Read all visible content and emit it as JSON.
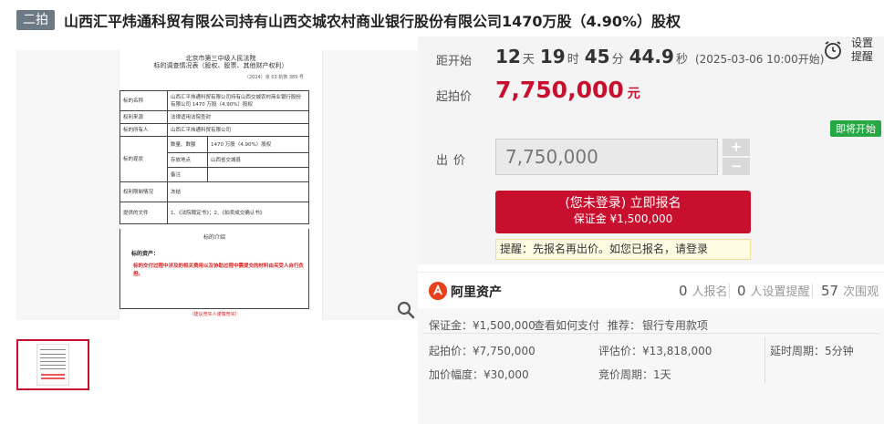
{
  "header": {
    "round_badge": "二拍",
    "title": "山西汇平炜通科贸有限公司持有山西交城农村商业银行股份有限公司1470万股（4.90%）股权"
  },
  "document": {
    "court": "北京市第三中级人民法院",
    "doc_title": "标的调查情况表（股权、股票、其他财产权利）",
    "doc_no": "（2024）京 03 执恢 385 号",
    "rows": [
      {
        "label": "标的名称",
        "value": "山西汇平炜通科贸有限公司持有山西交城农村商业银行股份有限公司 1470 万股（4.90%）股权"
      },
      {
        "label": "权利来源",
        "value": "法律适用法院查封"
      },
      {
        "label": "标的所有人",
        "value": "山西汇平炜通科贸有限公司"
      },
      {
        "label": "标的现状",
        "sub": [
          {
            "label": "数量、数额",
            "value": "1470 万股（4.90%）股权"
          },
          {
            "label": "存放地点",
            "value": "山西省交城县"
          },
          {
            "label": "备注",
            "value": ""
          }
        ]
      },
      {
        "label": "权利限制情况",
        "value": "冻结"
      },
      {
        "label": "提供的文件",
        "value": "1、《法院裁定书》；2、《拍卖成交确认书》"
      }
    ],
    "section_title": "标的介绍",
    "section_label": "标的资产：",
    "red_note": "标的交付过程中涉及的相关费用以及协助过程中需提交的材料由买受人自行负担。",
    "footer_note": "（建议竞买人谨慎竞买）"
  },
  "countdown": {
    "label": "距开始",
    "days": "12",
    "days_unit": "天",
    "hours": "19",
    "hours_unit": "时",
    "minutes": "45",
    "minutes_unit": "分",
    "seconds": "44.9",
    "seconds_unit": "秒",
    "start_note": "(2025-03-06 10:00开始)"
  },
  "reminder": {
    "line1": "设置",
    "line2": "提醒"
  },
  "start_price": {
    "label": "起拍价",
    "value": "7,750,000",
    "unit": "元"
  },
  "bid": {
    "status_tag": "即将开始",
    "label": "出价",
    "input_value": "7,750,000",
    "plus": "+",
    "minus": "−",
    "signup_main": "(您未登录) 立即报名",
    "signup_sub": "保证金 ¥1,500,000",
    "tip": "提醒：先报名再出价。如您已报名，请登录"
  },
  "platform": {
    "name": "阿里资产",
    "stats": [
      {
        "n": "0",
        "label": "人报名"
      },
      {
        "n": "0",
        "label": "人设置提醒"
      },
      {
        "n": "57",
        "label": "次围观"
      }
    ]
  },
  "info": {
    "deposit": "保证金：¥1,500,000",
    "deposit_link": "查看如何支付",
    "recommend_label": "推荐：",
    "recommend_link": "银行专用款项",
    "start_price": "起拍价：¥7,750,000",
    "appraisal": "评估价：¥13,818,000",
    "delay": "延时周期：5分钟",
    "increment": "加价幅度：¥30,000",
    "bid_cycle": "竞价周期：1天"
  },
  "colors": {
    "accent": "#c8102e",
    "status_green": "#28a745",
    "link": "#2b6ed2"
  }
}
